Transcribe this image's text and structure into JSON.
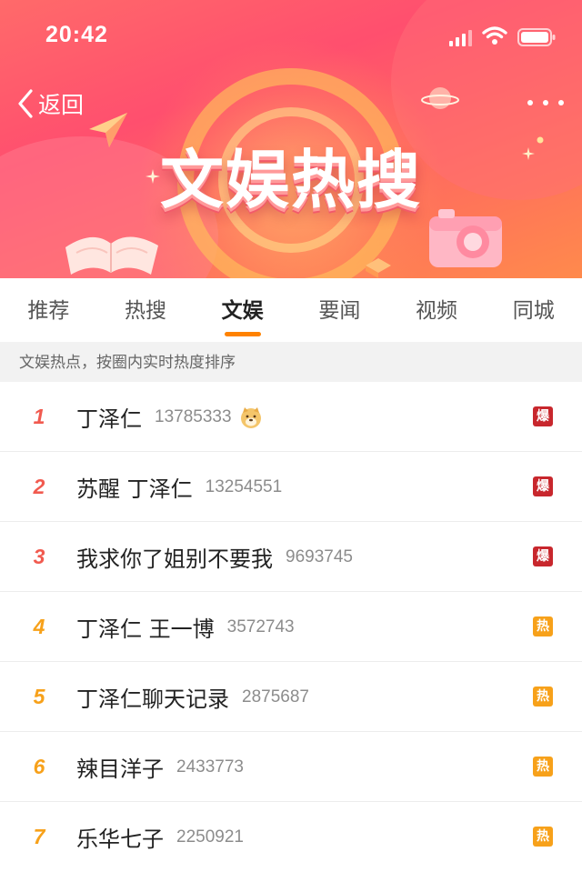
{
  "status_bar": {
    "time": "20:42"
  },
  "header": {
    "back_label": "返回",
    "title": "文娱热搜"
  },
  "tabs": [
    {
      "label": "推荐",
      "active": false
    },
    {
      "label": "热搜",
      "active": false
    },
    {
      "label": "文娱",
      "active": true
    },
    {
      "label": "要闻",
      "active": false
    },
    {
      "label": "视频",
      "active": false
    },
    {
      "label": "同城",
      "active": false
    }
  ],
  "subheader": "文娱热点，按圈内实时热度排序",
  "list": [
    {
      "rank": "1",
      "title": "丁泽仁",
      "count": "13785333",
      "emoji": "doge-emoji",
      "badge": "爆",
      "badge_color": "#c8272d"
    },
    {
      "rank": "2",
      "title": "苏醒 丁泽仁",
      "count": "13254551",
      "badge": "爆",
      "badge_color": "#c8272d"
    },
    {
      "rank": "3",
      "title": "我求你了姐别不要我",
      "count": "9693745",
      "badge": "爆",
      "badge_color": "#c8272d"
    },
    {
      "rank": "4",
      "title": "丁泽仁 王一博",
      "count": "3572743",
      "badge": "热",
      "badge_color": "#f7a11a"
    },
    {
      "rank": "5",
      "title": "丁泽仁聊天记录",
      "count": "2875687",
      "badge": "热",
      "badge_color": "#f7a11a"
    },
    {
      "rank": "6",
      "title": "辣目洋子",
      "count": "2433773",
      "badge": "热",
      "badge_color": "#f7a11a"
    },
    {
      "rank": "7",
      "title": "乐华七子",
      "count": "2250921",
      "badge": "热",
      "badge_color": "#f7a11a"
    }
  ],
  "colors": {
    "accent": "#ff8200",
    "rank_top": "#f15a4f",
    "rank_other": "#f7a11a",
    "badge_bao": "#c8272d",
    "badge_re": "#f7a11a"
  }
}
